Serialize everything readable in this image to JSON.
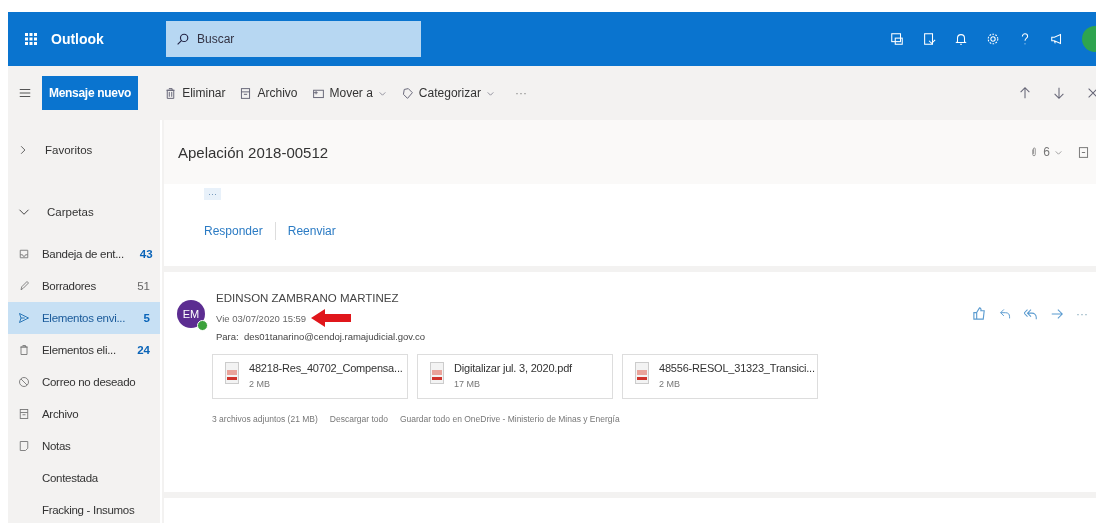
{
  "header": {
    "app_name": "Outlook",
    "search": {
      "placeholder": "Buscar"
    }
  },
  "toolbar": {
    "new_message": "Mensaje nuevo",
    "actions": [
      {
        "label": "Eliminar",
        "kind": "delete",
        "dropdown": false
      },
      {
        "label": "Archivo",
        "kind": "archive",
        "dropdown": false
      },
      {
        "label": "Mover a",
        "kind": "move",
        "dropdown": true
      },
      {
        "label": "Categorizar",
        "kind": "tag",
        "dropdown": true
      }
    ],
    "more": "···"
  },
  "folder_pane": {
    "favorites": "Favoritos",
    "folders_heading": "Carpetas",
    "items": [
      {
        "name": "Bandeja de ent...",
        "kind": "inbox",
        "count": "43",
        "unread": true,
        "selected": false
      },
      {
        "name": "Borradores",
        "kind": "drafts",
        "count": "51",
        "unread": false,
        "selected": false
      },
      {
        "name": "Elementos envi...",
        "kind": "sent",
        "count": "5",
        "unread": true,
        "selected": true
      },
      {
        "name": "Elementos eli...",
        "kind": "deleted",
        "count": "24",
        "unread": true,
        "selected": false
      },
      {
        "name": "Correo no deseado",
        "kind": "junk",
        "selected": false
      },
      {
        "name": "Archivo",
        "kind": "archive",
        "selected": false
      },
      {
        "name": "Notas",
        "kind": "notes",
        "selected": false
      },
      {
        "name": "Contestada",
        "kind": "plain",
        "selected": false
      },
      {
        "name": "Fracking - Insumos",
        "kind": "plain",
        "selected": false
      }
    ]
  },
  "reading_pane": {
    "subject": "Apelación 2018-00512",
    "attachment_count": "6",
    "collapsed_more": "···",
    "reply_actions": [
      "Responder",
      "Reenviar"
    ],
    "message": {
      "sender": "EDINSON ZAMBRANO MARTINEZ",
      "initials": "EM",
      "date": "Vie 03/07/2020 15:59",
      "to_label": "Para:",
      "to": "des01tanarino@cendoj.ramajudicial.gov.co",
      "more": "···",
      "attachments": [
        {
          "name": "48218-Res_40702_Compensa...",
          "size": "2 MB"
        },
        {
          "name": "Digitalizar jul. 3, 2020.pdf",
          "size": "17 MB"
        },
        {
          "name": "48556-RESOL_31323_Transici...",
          "size": "2 MB"
        }
      ],
      "attachments_summary": "3 archivos adjuntos (21 MB)",
      "download_all": "Descargar todo",
      "save_all": "Guardar todo en OneDrive - Ministerio de Minas y Energía"
    }
  }
}
